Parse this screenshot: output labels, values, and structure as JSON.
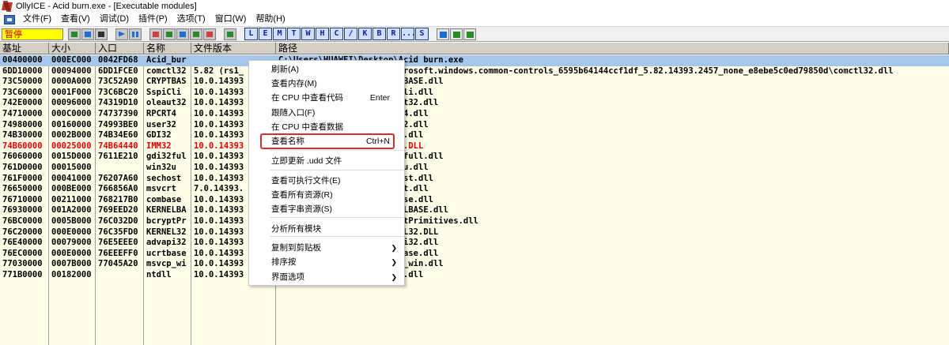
{
  "window": {
    "title": "OllyICE - Acid burn.exe - [Executable modules]"
  },
  "menubar": {
    "items": [
      "文件(F)",
      "查看(V)",
      "调试(D)",
      "插件(P)",
      "选项(T)",
      "窗口(W)",
      "帮助(H)"
    ]
  },
  "toolbar": {
    "status": "暂停",
    "letter_buttons": [
      "L",
      "E",
      "M",
      "T",
      "W",
      "H",
      "C",
      "/",
      "K",
      "B",
      "R",
      "...",
      "S"
    ]
  },
  "table": {
    "columns": [
      "基址",
      "大小",
      "入口",
      "名称",
      "文件版本",
      "路径"
    ],
    "rows": [
      {
        "base": "00400000",
        "size": "000EC000",
        "entry": "0042FD68",
        "name": "Acid_bur",
        "version": "",
        "path": "C:\\Users\\HUAWEI\\Desktop\\Acid burn.exe",
        "selected": true
      },
      {
        "base": "6DD10000",
        "size": "00094000",
        "entry": "6DD1FCE0",
        "name": "comctl32",
        "version": "5.82 (rs1_",
        "path": "C:\\Windows\\WinSxS\\x86_microsoft.windows.common-controls_6595b64144ccf1df_5.82.14393.2457_none_e8ebe5c0ed79850d\\comctl32.dll"
      },
      {
        "base": "73C50000",
        "size": "0000A000",
        "entry": "73C52A90",
        "name": "CRYPTBAS",
        "version": "10.0.14393",
        "path": "C:\\Windows\\System32\\CRYPTBASE.dll"
      },
      {
        "base": "73C60000",
        "size": "0001F000",
        "entry": "73C6BC20",
        "name": "SspiCli",
        "version": "10.0.14393",
        "path": "C:\\Windows\\System32\\SspiCli.dll"
      },
      {
        "base": "742E0000",
        "size": "00096000",
        "entry": "74319D10",
        "name": "oleaut32",
        "version": "10.0.14393",
        "path": "C:\\Windows\\System32\\oleaut32.dll"
      },
      {
        "base": "74710000",
        "size": "000C0000",
        "entry": "74737390",
        "name": "RPCRT4",
        "version": "10.0.14393",
        "path": "C:\\Windows\\System32\\RPCRT4.dll"
      },
      {
        "base": "74980000",
        "size": "00160000",
        "entry": "74993BE0",
        "name": "user32",
        "version": "10.0.14393",
        "path": "C:\\Windows\\System32\\user32.dll"
      },
      {
        "base": "74B30000",
        "size": "0002B000",
        "entry": "74B34E60",
        "name": "GDI32",
        "version": "10.0.14393",
        "path": "C:\\Windows\\System32\\GDI32.dll"
      },
      {
        "base": "74B60000",
        "size": "00025000",
        "entry": "74B64440",
        "name": "IMM32",
        "version": "10.0.14393",
        "path": "C:\\Windows\\System32\\IMM32.DLL",
        "red": true
      },
      {
        "base": "76060000",
        "size": "0015D000",
        "entry": "7611E210",
        "name": "gdi32ful",
        "version": "10.0.14393",
        "path": "C:\\Windows\\System32\\gdi32full.dll"
      },
      {
        "base": "761D0000",
        "size": "00015000",
        "entry": "",
        "name": "win32u",
        "version": "10.0.14393",
        "path": "C:\\Windows\\System32\\win32u.dll"
      },
      {
        "base": "761F0000",
        "size": "00041000",
        "entry": "76207A60",
        "name": "sechost",
        "version": "10.0.14393",
        "path": "C:\\Windows\\System32\\sechost.dll"
      },
      {
        "base": "76650000",
        "size": "000BE000",
        "entry": "766856A0",
        "name": "msvcrt",
        "version": "7.0.14393.",
        "path": "C:\\Windows\\System32\\msvcrt.dll"
      },
      {
        "base": "76710000",
        "size": "00211000",
        "entry": "768217B0",
        "name": "combase",
        "version": "10.0.14393",
        "path": "C:\\Windows\\System32\\combase.dll"
      },
      {
        "base": "76930000",
        "size": "001A2000",
        "entry": "769EED20",
        "name": "KERNELBA",
        "version": "10.0.14393",
        "path": "C:\\Windows\\System32\\KERNELBASE.dll"
      },
      {
        "base": "76BC0000",
        "size": "0005B000",
        "entry": "76C032D0",
        "name": "bcryptPr",
        "version": "10.0.14393",
        "path": "C:\\Windows\\System32\\bcryptPrimitives.dll"
      },
      {
        "base": "76C20000",
        "size": "000E0000",
        "entry": "76C35FD0",
        "name": "KERNEL32",
        "version": "10.0.14393",
        "path": "C:\\Windows\\System32\\KERNEL32.DLL"
      },
      {
        "base": "76E40000",
        "size": "00079000",
        "entry": "76E5EEE0",
        "name": "advapi32",
        "version": "10.0.14393",
        "path": "C:\\Windows\\System32\\advapi32.dll"
      },
      {
        "base": "76EC0000",
        "size": "000E0000",
        "entry": "76EEEFF0",
        "name": "ucrtbase",
        "version": "10.0.14393",
        "path": "C:\\Windows\\System32\\ucrtbase.dll"
      },
      {
        "base": "77030000",
        "size": "0007B000",
        "entry": "77045A20",
        "name": "msvcp_wi",
        "version": "10.0.14393",
        "path": "C:\\Windows\\System32\\msvcp_win.dll"
      },
      {
        "base": "771B0000",
        "size": "00182000",
        "entry": "",
        "name": "ntdll",
        "version": "10.0.14393",
        "path": "C:\\Windows\\SYSTEM32\\ntdll.dll"
      }
    ]
  },
  "context_menu": {
    "items": [
      {
        "label": "刷新(A)"
      },
      {
        "label": "查看内存(M)"
      },
      {
        "label": "在 CPU 中查看代码",
        "shortcut": "Enter"
      },
      {
        "label": "跟随入口(F)"
      },
      {
        "label": "在 CPU 中查看数据"
      },
      {
        "label": "查看名称",
        "shortcut": "Ctrl+N"
      },
      {
        "label": "立即更新 .udd 文件"
      },
      {
        "label": "查看可执行文件(E)"
      },
      {
        "label": "查看所有资源(R)"
      },
      {
        "label": "查看字串资源(S)"
      },
      {
        "label": "分析所有模块"
      },
      {
        "label": "复制到剪贴板",
        "submenu": true
      },
      {
        "label": "排序按",
        "submenu": true
      },
      {
        "label": "界面选项",
        "submenu": true
      }
    ]
  },
  "colors": {
    "selected_row": "#a7c7ea",
    "highlight_row_text": "#e00000",
    "table_bg": "#fffce8",
    "status_bg": "#ffff00",
    "annotation_box": "#d03030"
  }
}
